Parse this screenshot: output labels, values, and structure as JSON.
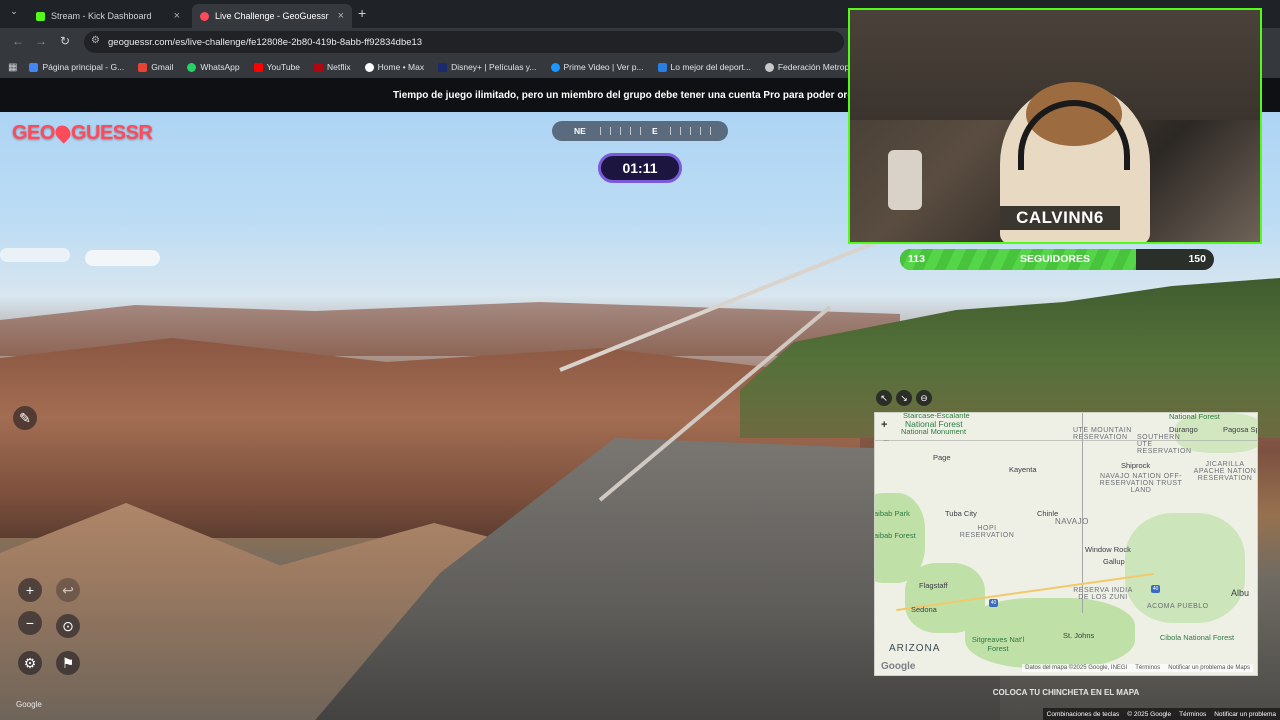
{
  "browser": {
    "tabs": [
      {
        "label": "Stream - Kick Dashboard",
        "active": false
      },
      {
        "label": "Live Challenge - GeoGuessr",
        "active": true
      }
    ],
    "url": "geoguessr.com/es/live-challenge/fe12808e-2b80-419b-8abb-ff92834dbe13",
    "bookmarks": [
      "Página principal - G...",
      "Gmail",
      "WhatsApp",
      "YouTube",
      "Netflix",
      "Home • Max",
      "Disney+ | Películas y...",
      "Prime Video | Ver p...",
      "Lo mejor del deport...",
      "Federación Metrop..."
    ]
  },
  "game": {
    "notice": "Tiempo de juego ilimitado, pero un miembro del grupo debe tener una cuenta Pro para poder organiza",
    "logo": "GEOGUESSR",
    "compass": {
      "left": "NE",
      "right": "E"
    },
    "timer": "01:11",
    "corner_label": "Google",
    "place_pin_label": "COLOCA TU CHINCHETA EN EL MAPA",
    "footer": [
      "Combinaciones de teclas",
      "© 2025 Google",
      "Términos",
      "Notificar un problema"
    ]
  },
  "map": {
    "labels": {
      "monument": "National Monument",
      "monument_top": "Staircase-Escalante",
      "national_forest": "National Forest",
      "ute": "UTE MOUNTAIN RESERVATION",
      "southern_ute": "SOUTHERN UTE RESERVATION",
      "durango": "Durango",
      "pagosa": "Pagosa Springs",
      "page": "Page",
      "kayenta": "Kayenta",
      "shiprock": "Shiprock",
      "navajo_trust": "NAVAJO NATION OFF-RESERVATION TRUST LAND",
      "jicarilla": "JICARILLA APACHE NATION RESERVATION",
      "kaibab_park": "aibab Park",
      "tuba_city": "Tuba City",
      "chinle": "Chinle",
      "navajo": "NAVAJO",
      "kaibab_forest": "aibab Forest",
      "hopi": "HOPI RESERVATION",
      "window_rock": "Window Rock",
      "gallup": "Gallup",
      "flagstaff": "Flagstaff",
      "sedona": "Sedona",
      "zuni": "RESERVA INDIA DE LOS ZUNI",
      "acoma": "ACOMA PUEBLO",
      "albuquerque": "Albu",
      "arizona": "ARIZONA",
      "sitgreaves": "Sitgreaves Nat'l Forest",
      "st_johns": "St. Johns",
      "cibola": "Cibola National Forest"
    },
    "attribution": [
      "Datos del mapa ©2025 Google, INEGI",
      "Términos",
      "Notificar un problema de Maps"
    ],
    "logo": "Google"
  },
  "stream": {
    "streamer_name": "CALVINN6",
    "followers_label": "SEGUIDORES",
    "followers_current": "113",
    "followers_goal": "150",
    "progress": 0.753
  }
}
